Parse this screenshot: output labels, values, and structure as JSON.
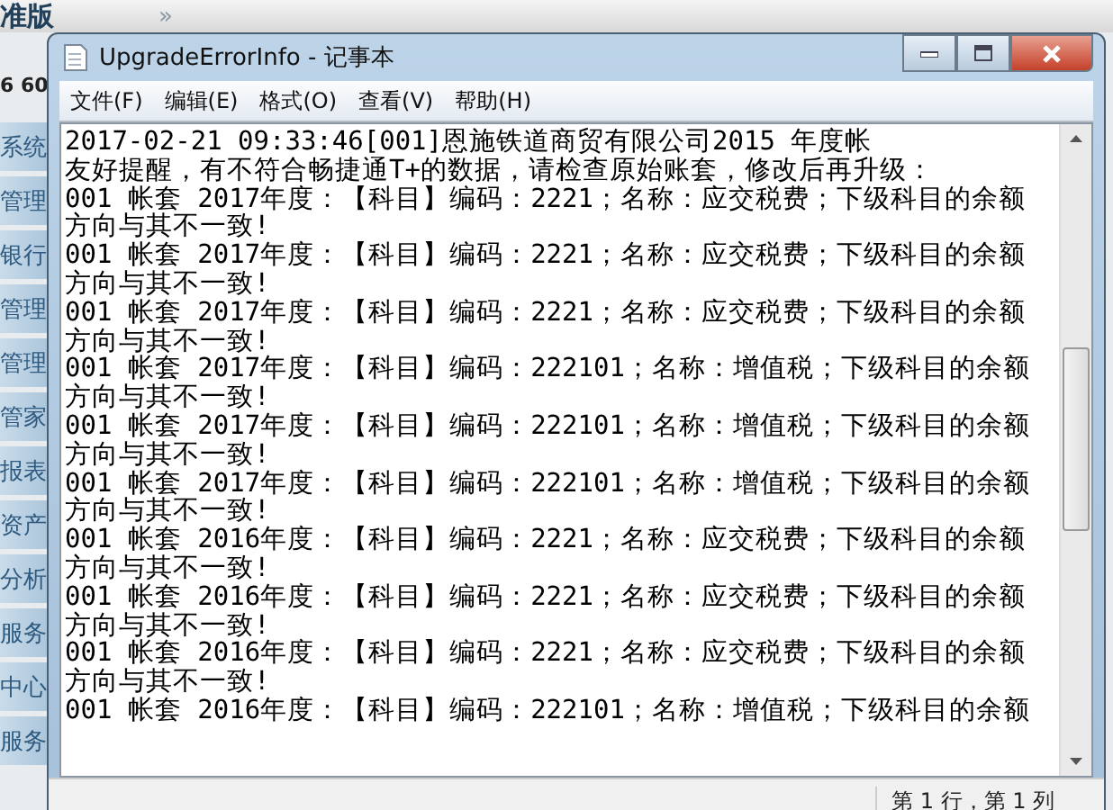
{
  "background_app": {
    "toolbar_glyph": "»",
    "title": "准版",
    "subtitle": "6 60",
    "sidebar": [
      "系统",
      "管理",
      "银行",
      "管理",
      "管理",
      "管家",
      "报表",
      "资产",
      "分析",
      "服务",
      "中心",
      "服务"
    ]
  },
  "window": {
    "title": "UpgradeErrorInfo - 记事本"
  },
  "menu": [
    "文件(F)",
    "编辑(E)",
    "格式(O)",
    "查看(V)",
    "帮助(H)"
  ],
  "lines": [
    "2017-02-21 09:33:46[001]恩施铁道商贸有限公司2015 年度帐",
    "友好提醒，有不符合畅捷通T+的数据，请检查原始账套，修改后再升级：",
    "001 帐套 2017年度：【科目】编码：2221；名称：应交税费；下级科目的余额",
    "方向与其不一致!",
    "001 帐套 2017年度：【科目】编码：2221；名称：应交税费；下级科目的余额",
    "方向与其不一致!",
    "001 帐套 2017年度：【科目】编码：2221；名称：应交税费；下级科目的余额",
    "方向与其不一致!",
    "001 帐套 2017年度：【科目】编码：222101；名称：增值税；下级科目的余额",
    "方向与其不一致!",
    "001 帐套 2017年度：【科目】编码：222101；名称：增值税；下级科目的余额",
    "方向与其不一致!",
    "001 帐套 2017年度：【科目】编码：222101；名称：增值税；下级科目的余额",
    "方向与其不一致!",
    "001 帐套 2016年度：【科目】编码：2221；名称：应交税费；下级科目的余额",
    "方向与其不一致!",
    "001 帐套 2016年度：【科目】编码：2221；名称：应交税费；下级科目的余额",
    "方向与其不一致!",
    "001 帐套 2016年度：【科目】编码：2221；名称：应交税费；下级科目的余额",
    "方向与其不一致!",
    "001 帐套 2016年度：【科目】编码：222101；名称：增值税；下级科目的余额"
  ],
  "status_bar": "第 1 行，第 1 列"
}
